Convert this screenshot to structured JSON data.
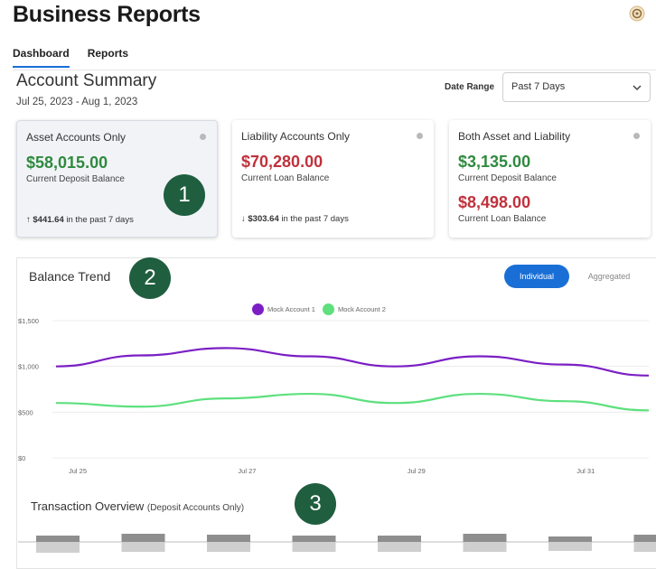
{
  "app": {
    "title": "Business Reports"
  },
  "header": {
    "settings_icon": "gear-icon"
  },
  "tabs": [
    {
      "label": "Dashboard",
      "active": true
    },
    {
      "label": "Reports",
      "active": false
    }
  ],
  "summary": {
    "title": "Account Summary",
    "date": "Jul 25, 2023 - Aug 1, 2023",
    "date_range_label": "Date Range",
    "date_range_value": "Past 7 Days"
  },
  "cards": [
    {
      "title": "Asset Accounts Only",
      "amount": "$58,015.00",
      "amount_label": "Current Deposit Balance",
      "change_prefix": "↑ ",
      "change_value": "$441.64",
      "change_suffix": " in the past 7 days"
    },
    {
      "title": "Liability Accounts Only",
      "amount": "$70,280.00",
      "amount_label": "Current Loan Balance",
      "change_prefix": "↓ ",
      "change_value": "$303.64",
      "change_suffix": " in the past 7 days"
    },
    {
      "title": "Both Asset and Liability",
      "amount": "$3,135.00",
      "amount_label": "Current Deposit Balance",
      "amount2": "$8,498.00",
      "amount2_label": "Current Loan Balance"
    }
  ],
  "badges": [
    "1",
    "2",
    "3"
  ],
  "trend": {
    "title": "Balance Trend",
    "toggle_individual": "Individual",
    "toggle_aggregated": "Aggregated"
  },
  "transactions": {
    "title": "Transaction Overview",
    "subtitle": "(Deposit Accounts Only)"
  },
  "colors": {
    "accent": "#1a6fd6",
    "badge": "#1f5e3e",
    "positive": "#2f8a3e",
    "negative": "#c0313c"
  },
  "chart_data": {
    "type": "line",
    "y_ticks": [
      "$1,500",
      "$1,000",
      "$500",
      "$0"
    ],
    "x_ticks": [
      "Jul 25",
      "Jul 27",
      "Jul 29",
      "Jul 31"
    ],
    "ylim": [
      0,
      1500
    ],
    "grid": true,
    "legend_placement": "top-center",
    "x": [
      0,
      1,
      2,
      3,
      4,
      5,
      6,
      7
    ],
    "series": [
      {
        "name": "Mock Account 1",
        "color": "#7b1fc4",
        "values": [
          1000,
          1120,
          1200,
          1110,
          1000,
          1110,
          1020,
          900
        ]
      },
      {
        "name": "Mock Account 2",
        "color": "#5ee07e",
        "values": [
          600,
          560,
          650,
          700,
          600,
          700,
          620,
          520
        ]
      }
    ]
  },
  "transaction_bars": {
    "deposits": [
      0.35,
      0.45,
      0.4,
      0.35,
      0.35,
      0.45,
      0.3,
      0.4
    ],
    "withdrawals": [
      0.6,
      0.55,
      0.55,
      0.55,
      0.55,
      0.55,
      0.5,
      0.55
    ]
  }
}
